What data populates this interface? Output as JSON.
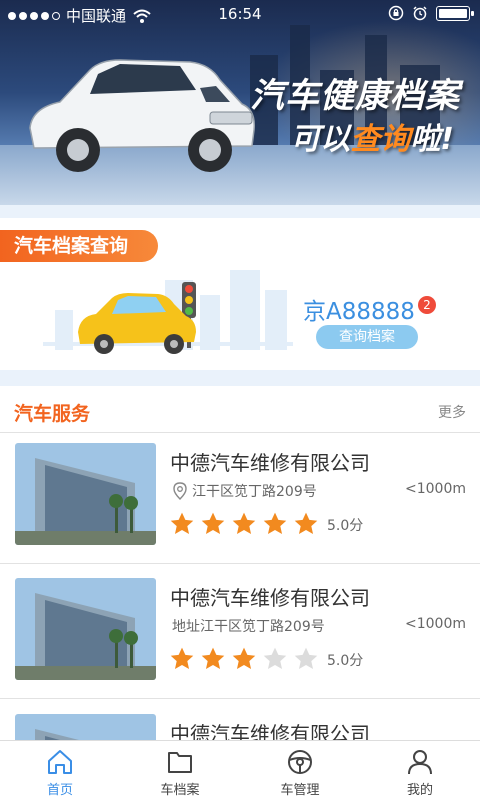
{
  "status_bar": {
    "carrier": "中国联通",
    "time": "16:54"
  },
  "banner": {
    "title": "汽车健康档案",
    "subtitle_prefix": "可以",
    "subtitle_highlight": "查询",
    "subtitle_suffix": "啦!"
  },
  "archive": {
    "tag": "汽车档案查询",
    "plate": "京A88888",
    "badge": "2",
    "query_button": "查询档案"
  },
  "services": {
    "title": "汽车服务",
    "more": "更多",
    "items": [
      {
        "name": "中德汽车维修有限公司",
        "address": "江干区笕丁路209号",
        "distance": "<1000m",
        "rating": 5,
        "score": "5.0分"
      },
      {
        "name": "中德汽车维修有限公司",
        "address": "地址江干区笕丁路209号",
        "distance": "<1000m",
        "rating": 3,
        "score": "5.0分"
      },
      {
        "name": "中德汽车维修有限公司"
      }
    ]
  },
  "tabbar": {
    "tabs": [
      {
        "label": "首页",
        "icon": "home-icon",
        "active": true
      },
      {
        "label": "车档案",
        "icon": "folder-icon",
        "active": false
      },
      {
        "label": "车管理",
        "icon": "steering-wheel-icon",
        "active": false
      },
      {
        "label": "我的",
        "icon": "user-icon",
        "active": false
      }
    ]
  },
  "colors": {
    "accent_orange": "#f2641f",
    "accent_blue": "#3a8ee6",
    "star_on": "#f28a1f",
    "star_off": "#dcdcdc"
  }
}
